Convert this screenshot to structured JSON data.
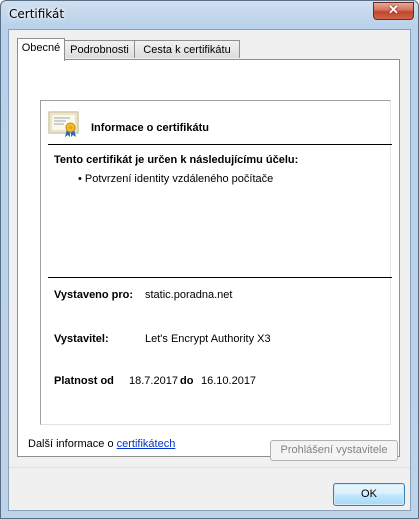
{
  "window": {
    "title": "Certifikát"
  },
  "tabs": [
    {
      "label": "Obecné",
      "active": true
    },
    {
      "label": "Podrobnosti",
      "active": false
    },
    {
      "label": "Cesta k certifikátu",
      "active": false
    }
  ],
  "general": {
    "info_title": "Informace o certifikátu",
    "purpose_heading": "Tento certifikát je určen k následujícímu účelu:",
    "purposes": [
      "• Potvrzení identity vzdáleného počítače"
    ],
    "issued_to_label": "Vystaveno pro:",
    "issued_to_value": "static.poradna.net",
    "issuer_label": "Vystavitel:",
    "issuer_value": "Let's Encrypt Authority X3",
    "validity_label": "Platnost od",
    "valid_from": "18.7.2017",
    "to_label": "do",
    "valid_to": "16.10.2017",
    "issuer_statement_button": "Prohlášení vystavitele"
  },
  "footer": {
    "more_info_prefix": "Další informace o ",
    "more_info_link": "certifikátech",
    "ok_button": "OK"
  },
  "icons": {
    "close": "close-icon",
    "certificate": "certificate-icon"
  },
  "colors": {
    "link": "#0033cc",
    "close_button": "#c0452c",
    "ok_button_border": "#3c7fb1"
  }
}
